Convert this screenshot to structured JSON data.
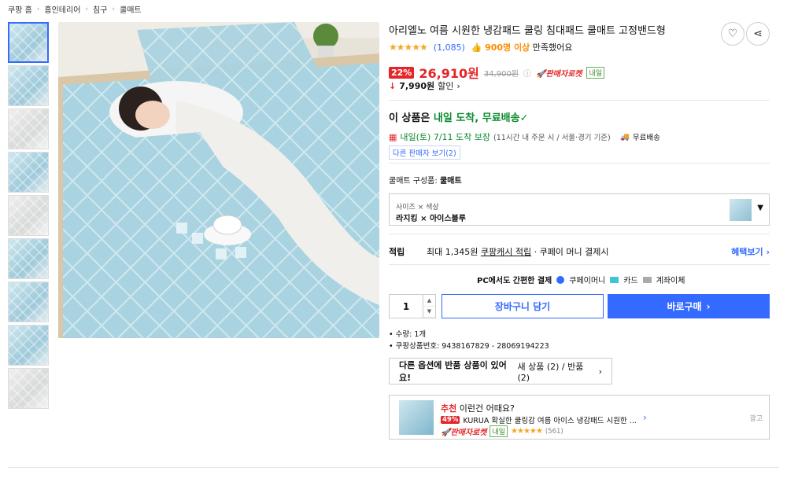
{
  "breadcrumb": [
    "쿠팡 홈",
    "홈인테리어",
    "침구",
    "쿨매트"
  ],
  "product": {
    "title": "아리엘노 여름 시원한 냉감패드 쿨링 침대패드 쿨매트 고정밴드형",
    "stars": "★★★★★",
    "reviews": "(1,085)",
    "satisfaction_count": "900명 이상",
    "satisfaction_text": "만족했어요",
    "discount": "22%",
    "price": "26,910원",
    "original_price": "34,900원",
    "rocket_label": "판매자로켓",
    "tomorrow_badge": "내일",
    "coupon_amount": "7,990원",
    "coupon_label": "할인"
  },
  "shipping": {
    "headline_prefix": "이 상품은",
    "headline_green": "내일 도착, 무료배송",
    "date_green": "내일(토) 7/11 도착 보장",
    "date_note": "(11시간 내 주문 시 / 서울·경기 기준)",
    "free_label": "무료배송",
    "other_seller": "다른 판매자 보기(2)"
  },
  "composition": {
    "label": "쿨매트 구성품:",
    "value": "쿨매트"
  },
  "option": {
    "keys": "사이즈 × 색상",
    "value": "라지킹 × 아이스블루"
  },
  "reward": {
    "label": "적립",
    "prefix": "최대 1,345원",
    "link": "쿠팡캐시 적립",
    "suffix": "· 쿠페이 머니 결제시",
    "benefit": "혜택보기"
  },
  "pay": {
    "title": "PC에서도 간편한 결제",
    "m1": "쿠페이머니",
    "m2": "카드",
    "m3": "계좌이체"
  },
  "actions": {
    "qty": "1",
    "cart": "장바구니 담기",
    "buy": "바로구매"
  },
  "facts": [
    "수량: 1개",
    "쿠팡상품번호: 9438167829 - 28069194223"
  ],
  "options_banner": {
    "bold": "다른 옵션에 반품 상품이 있어요!",
    "rest": "새 상품 (2) / 반품 (2)"
  },
  "reco": {
    "tag": "추천",
    "title": "이런건 어때요?",
    "discount": "49%",
    "name": "KURUA 확실한 쿨링감 여름 아이스 냉감패드 시원한 ...",
    "rocket": "판매자로켓",
    "tomorrow": "내일",
    "stars": "★★★★★",
    "count": "(561)",
    "ad": "광고"
  },
  "colors": {
    "accent": "#346aff",
    "price": "#e52528",
    "green": "#0a8a2f"
  }
}
